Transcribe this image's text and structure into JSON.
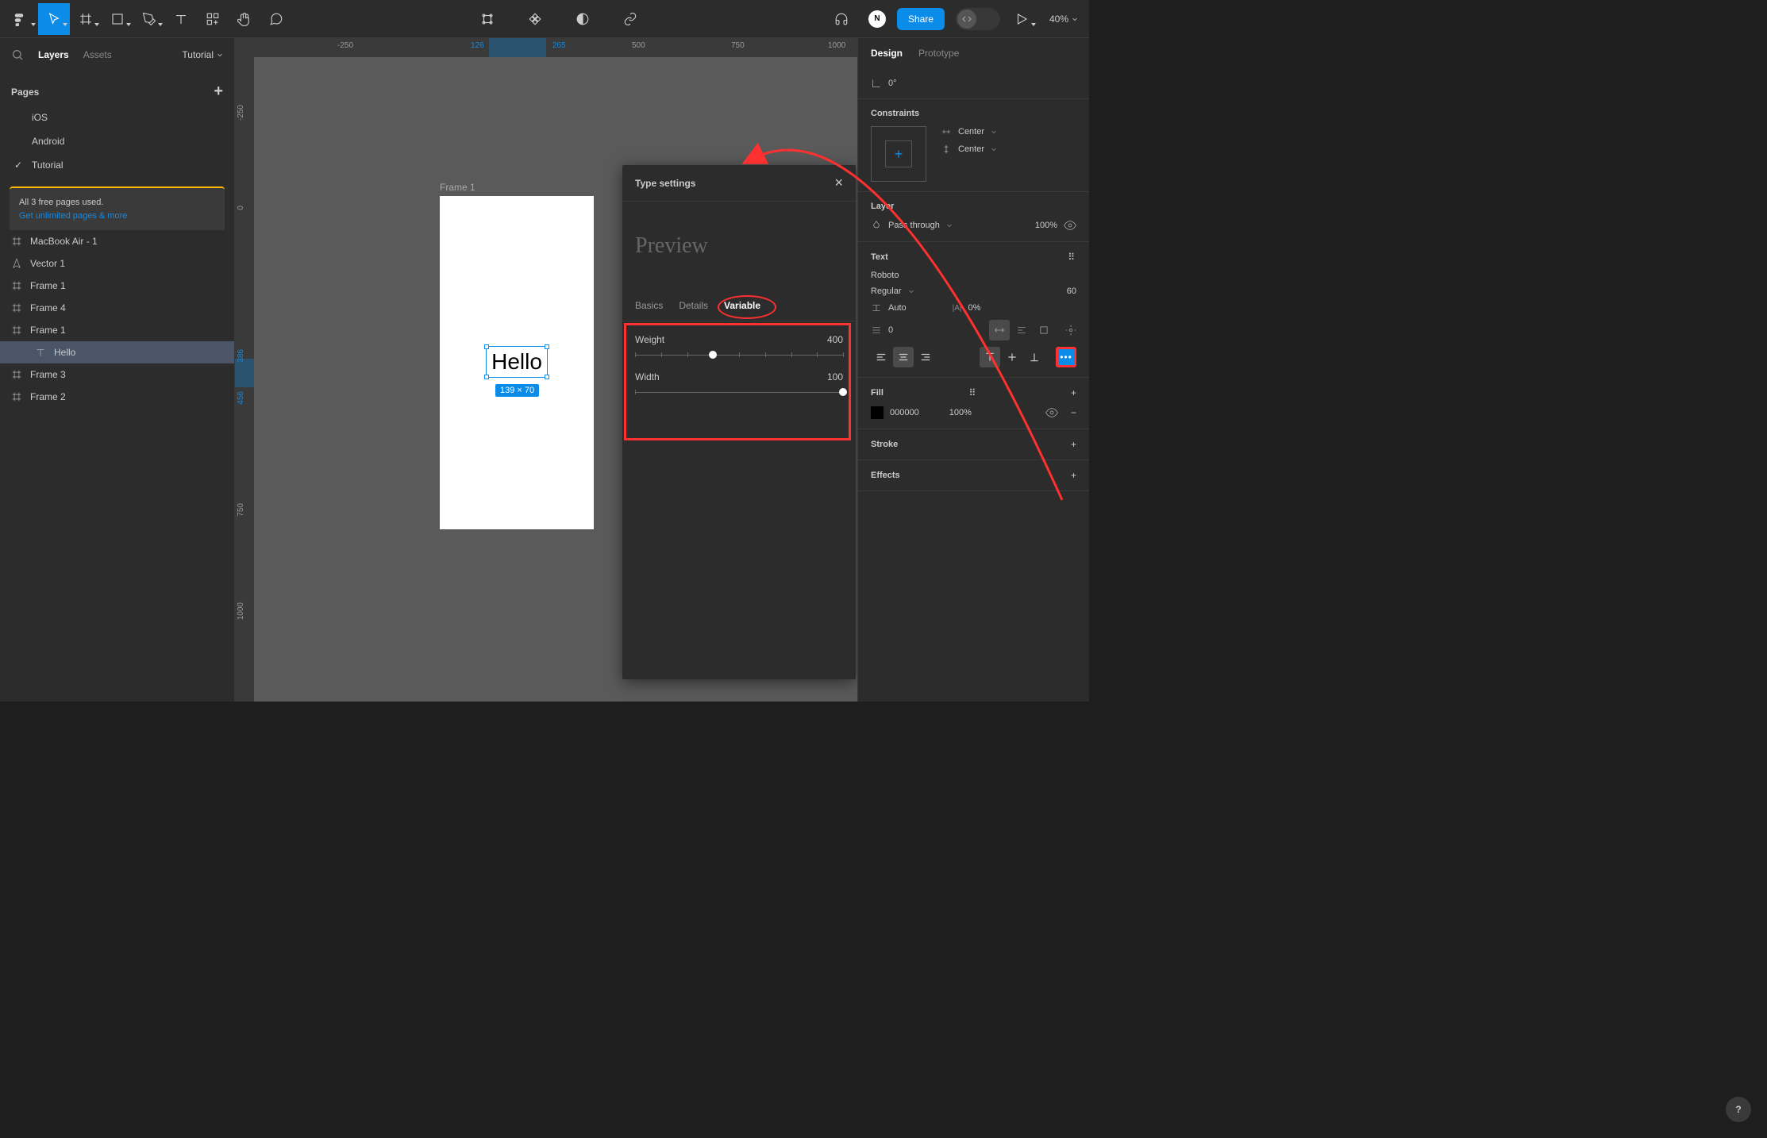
{
  "toolbar": {
    "share": "Share",
    "zoom": "40%"
  },
  "left": {
    "tabs": {
      "layers": "Layers",
      "assets": "Assets"
    },
    "filename": "Tutorial",
    "pages_header": "Pages",
    "pages": [
      "iOS",
      "Android",
      "Tutorial"
    ],
    "upgrade_line1": "All 3 free pages used.",
    "upgrade_link": "Get unlimited pages & more",
    "layers": [
      {
        "name": "MacBook Air - 1",
        "icon": "frame"
      },
      {
        "name": "Vector 1",
        "icon": "vector"
      },
      {
        "name": "Frame 1",
        "icon": "frame"
      },
      {
        "name": "Frame 4",
        "icon": "frame"
      },
      {
        "name": "Frame 1",
        "icon": "frame"
      },
      {
        "name": "Hello",
        "icon": "text",
        "indent": true,
        "selected": true
      },
      {
        "name": "Frame 3",
        "icon": "frame"
      },
      {
        "name": "Frame 2",
        "icon": "frame"
      }
    ]
  },
  "canvas": {
    "frame_label": "Frame 1",
    "text_content": "Hello",
    "selection_dim": "139 × 70",
    "ruler_h": [
      "-250",
      "126",
      "265",
      "500",
      "750",
      "1000"
    ],
    "ruler_v": [
      "-250",
      "0",
      "386",
      "456",
      "750",
      "1000"
    ]
  },
  "popup": {
    "title": "Type settings",
    "preview": "Preview",
    "tabs": [
      "Basics",
      "Details",
      "Variable"
    ],
    "weight_label": "Weight",
    "weight_value": "400",
    "width_label": "Width",
    "width_value": "100"
  },
  "right": {
    "tabs": {
      "design": "Design",
      "prototype": "Prototype"
    },
    "rotation": "0°",
    "constraints_label": "Constraints",
    "constraint_h": "Center",
    "constraint_v": "Center",
    "layer_label": "Layer",
    "blend": "Pass through",
    "opacity": "100%",
    "text_label": "Text",
    "font": "Roboto",
    "weight": "Regular",
    "size": "60",
    "line_height": "Auto",
    "letter_spacing": "0%",
    "paragraph_spacing": "0",
    "fill_label": "Fill",
    "fill_hex": "000000",
    "fill_opacity": "100%",
    "stroke_label": "Stroke",
    "effects_label": "Effects"
  }
}
